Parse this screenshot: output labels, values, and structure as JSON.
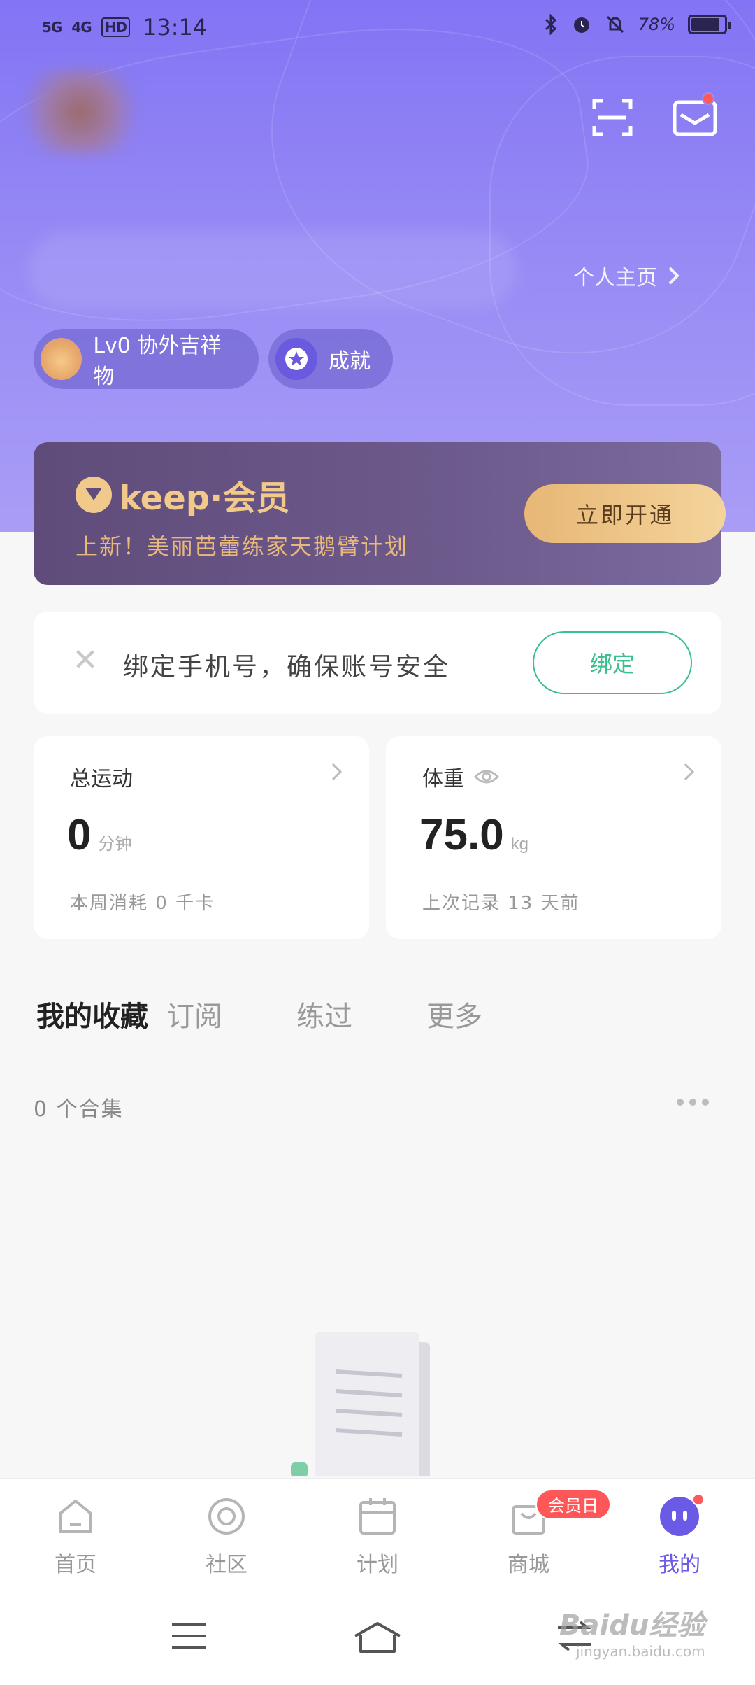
{
  "status_bar": {
    "network1": "5G",
    "network2": "4G",
    "hd": "HD",
    "time": "13:14",
    "battery": "78%"
  },
  "header": {
    "profile_link": "个人主页",
    "level_chip": "Lv0 协外吉祥物",
    "achievement_chip": "成就"
  },
  "vip": {
    "brand": "keep·会员",
    "slogan": "上新！美丽芭蕾练家天鹅臂计划",
    "button": "立即开通"
  },
  "bind_phone": {
    "text": "绑定手机号，确保账号安全",
    "button": "绑定"
  },
  "stats": {
    "exercise": {
      "title": "总运动",
      "value": "0",
      "unit": "分钟",
      "sub": "本周消耗 0 千卡"
    },
    "weight": {
      "title": "体重",
      "value": "75.0",
      "unit": "kg",
      "sub": "上次记录 13 天前"
    }
  },
  "tabs": [
    "我的收藏",
    "订阅",
    "练过",
    "更多"
  ],
  "collection": {
    "count": "0 个合集"
  },
  "tabbar": {
    "items": [
      "首页",
      "社区",
      "计划",
      "商城",
      "我的"
    ],
    "vip_day_badge": "会员日"
  },
  "watermark": {
    "main": "Baidu经验",
    "sub": "jingyan.baidu.com"
  },
  "colors": {
    "hero": "#8a7cf5",
    "accent_green": "#38c08d",
    "gold": "#f1c98b",
    "active_tab": "#6b5ae6"
  }
}
